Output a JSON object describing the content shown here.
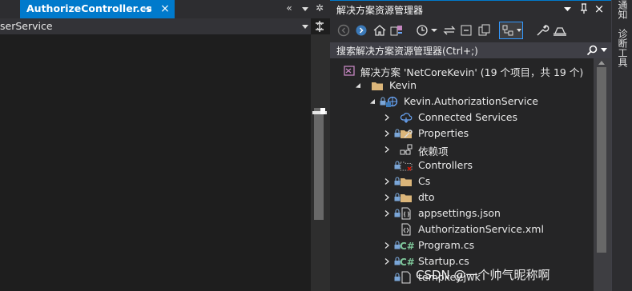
{
  "editor": {
    "tab_title": "AuthorizeController.cs",
    "tab_close": "×",
    "overflow_label": "«",
    "settings_label": "✲",
    "nav_text": "serService"
  },
  "solution_explorer": {
    "title": "解决方案资源管理器",
    "close_label": "×",
    "search_placeholder": "搜索解决方案资源管理器(Ctrl+;)",
    "toolbar_icons": [
      "back-icon",
      "forward-icon",
      "home-icon",
      "switch-views-icon",
      "pending-changes-filter-icon",
      "sync-icon",
      "collapse-all-icon",
      "show-all-files-icon",
      "preview-selected-icon",
      "properties-icon",
      "settings-icon"
    ],
    "tree": [
      {
        "label": "解决方案 'NetCoreKevin' (19 个项目，共 19 个)",
        "icon": "solution-icon",
        "expander": "none",
        "locked": false
      },
      {
        "label": "Kevin",
        "icon": "folder-icon",
        "expander": "expanded",
        "locked": false
      },
      {
        "label": "Kevin.AuthorizationService",
        "icon": "web-project-icon",
        "expander": "expanded",
        "locked": true
      },
      {
        "label": "Connected Services",
        "icon": "connected-services-icon",
        "expander": "collapsed",
        "locked": false
      },
      {
        "label": "Properties",
        "icon": "properties-folder-icon",
        "expander": "collapsed",
        "locked": true
      },
      {
        "label": "依赖项",
        "icon": "dependencies-icon",
        "expander": "collapsed",
        "locked": false
      },
      {
        "label": "Controllers",
        "icon": "excluded-folder-icon",
        "expander": "none",
        "locked": true
      },
      {
        "label": "Cs",
        "icon": "folder-icon",
        "expander": "collapsed",
        "locked": true
      },
      {
        "label": "dto",
        "icon": "folder-icon",
        "expander": "collapsed",
        "locked": true
      },
      {
        "label": "appsettings.json",
        "icon": "json-file-icon",
        "expander": "collapsed",
        "locked": true
      },
      {
        "label": "AuthorizationService.xml",
        "icon": "xml-file-icon",
        "expander": "none",
        "locked": false
      },
      {
        "label": "Program.cs",
        "icon": "csharp-file-icon",
        "expander": "collapsed",
        "locked": true
      },
      {
        "label": "Startup.cs",
        "icon": "csharp-file-icon",
        "expander": "collapsed",
        "locked": true
      },
      {
        "label": "tempkey.jwk",
        "icon": "file-icon",
        "expander": "none",
        "locked": true
      }
    ]
  },
  "side_panel": {
    "tabs": [
      "通知",
      "诊断工具"
    ]
  },
  "watermark": "CSDN @一个帅气昵称啊",
  "colors": {
    "accent": "#007acc",
    "folder": "#dcb67a",
    "csharp": "#68217a"
  }
}
